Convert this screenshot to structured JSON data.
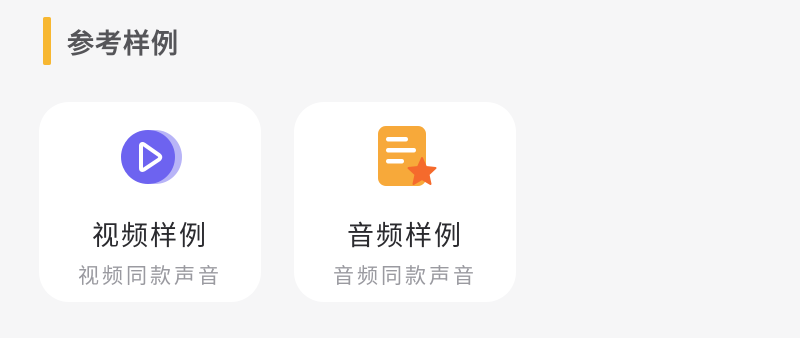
{
  "section": {
    "title": "参考样例",
    "accent_color": "#f7b731"
  },
  "cards": [
    {
      "title": "视频样例",
      "subtitle": "视频同款声音",
      "icon": "video-play-icon",
      "icon_color": "#6d63f0"
    },
    {
      "title": "音频样例",
      "subtitle": "音频同款声音",
      "icon": "audio-document-star-icon",
      "icon_color": "#f7a93a"
    }
  ]
}
